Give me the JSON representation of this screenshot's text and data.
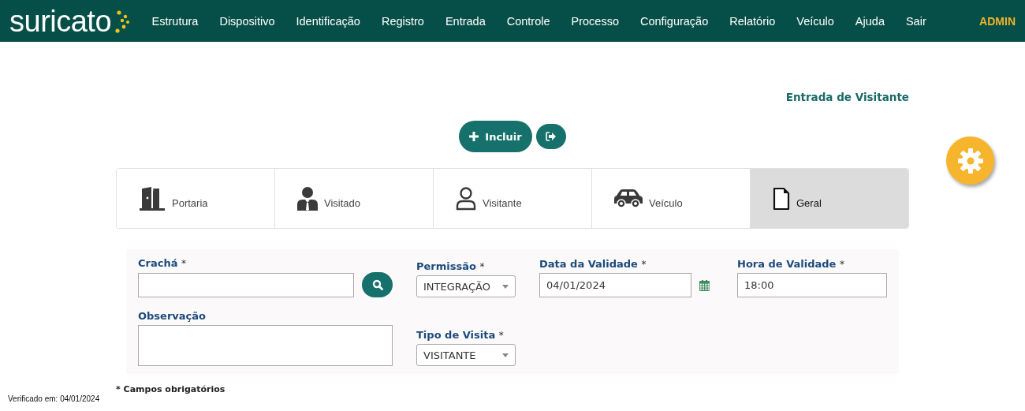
{
  "header": {
    "logo": "suricato",
    "nav": [
      "Estrutura",
      "Dispositivo",
      "Identificação",
      "Registro",
      "Entrada",
      "Controle",
      "Processo",
      "Configuração",
      "Relatório",
      "Veículo",
      "Ajuda",
      "Sair"
    ],
    "user": "ADMIN"
  },
  "page_title": "Entrada de Visitante",
  "actions": {
    "include_label": "Incluir"
  },
  "steps": [
    {
      "label": "Portaria",
      "selected": false
    },
    {
      "label": "Visitado",
      "selected": false
    },
    {
      "label": "Visitante",
      "selected": false
    },
    {
      "label": "Veículo",
      "selected": false
    },
    {
      "label": "Geral",
      "selected": true
    }
  ],
  "form": [
    {
      "kind": "search",
      "label": "Crachá",
      "mark": "*"
    },
    {
      "kind": "select",
      "label": "Permissão",
      "mark": "*",
      "value": "INTEGRAÇÃO"
    },
    {
      "kind": "date",
      "label": "Data da Validade",
      "mark": "*",
      "value": "04/01/2024"
    },
    {
      "kind": "text",
      "label": "Hora de Validade",
      "mark": "*",
      "value": "18:00"
    },
    {
      "kind": "textarea",
      "label": "Observação"
    },
    {
      "kind": "select",
      "label": "Tipo de Visita",
      "mark": "*",
      "value": "VISITANTE"
    }
  ],
  "required_note": "* Campos obrigatórios",
  "footer": "Verificado em: 04/01/2024"
}
